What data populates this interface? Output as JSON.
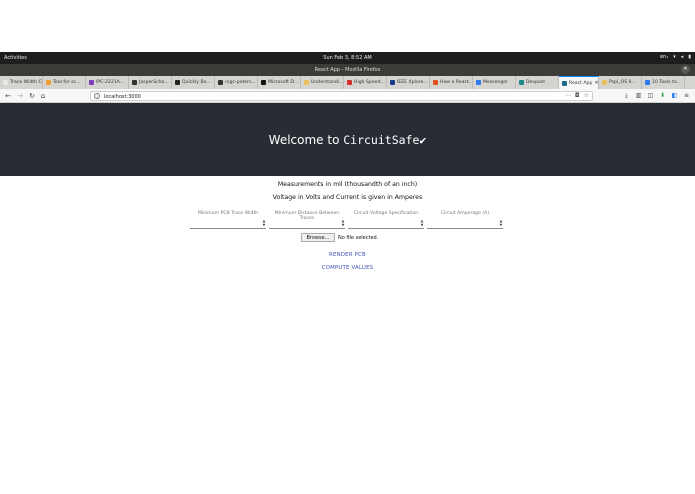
{
  "system_bar": {
    "activities": "Activities",
    "clock": "Sun Feb  3,  8:52 AM",
    "locale": "en₁",
    "tray_icons": [
      "wifi-icon",
      "volume-icon",
      "battery-icon"
    ]
  },
  "browser": {
    "window_title": "React App - Mozilla Firefox",
    "tabs": [
      {
        "label": "Trace Width C...",
        "color": "#e8e8e8"
      },
      {
        "label": "Tool for sc...",
        "color": "#f0a030"
      },
      {
        "label": "IPC-2221A...",
        "color": "#7a3fb8"
      },
      {
        "label": "JasperScho...",
        "color": "#333333"
      },
      {
        "label": "Quickly Bo...",
        "color": "#222222"
      },
      {
        "label": "rogc-peters...",
        "color": "#333333"
      },
      {
        "label": "Microsoft D...",
        "color": "#111111"
      },
      {
        "label": "Understandi...",
        "color": "#e8c060"
      },
      {
        "label": "High Speed...",
        "color": "#d03030"
      },
      {
        "label": "IEEE Xplore...",
        "color": "#1a3a8a"
      },
      {
        "label": "How a React...",
        "color": "#e05020"
      },
      {
        "label": "Messenger",
        "color": "#2a7af0"
      },
      {
        "label": "Devpost",
        "color": "#1a8a8a"
      },
      {
        "label": "React App",
        "color": "#1a6a8a",
        "active": true
      },
      {
        "label": "Pspi_OS II...",
        "color": "#e8c060"
      },
      {
        "label": "10 Tools to...",
        "color": "#2a7af0"
      }
    ],
    "url": "localhost:3000"
  },
  "app": {
    "header_prefix": "Welcome to ",
    "header_brand": "CircuitSafe✔",
    "measure_note": "Measurements in mil (thousandth of an inch)",
    "units_note": "Voltage in Volts and Current is given in Amperes",
    "fields": [
      {
        "label": "Minimum PCB Trace Width"
      },
      {
        "label": "Minimum Distance Between Traces"
      },
      {
        "label": "Circuit Voltage Specification"
      },
      {
        "label": "Circuit Amperage (A)"
      }
    ],
    "browse_label": "Browse...",
    "no_file_text": "No file selected.",
    "render_label": "RENDER PCB",
    "compute_label": "COMPUTE VALUES"
  }
}
